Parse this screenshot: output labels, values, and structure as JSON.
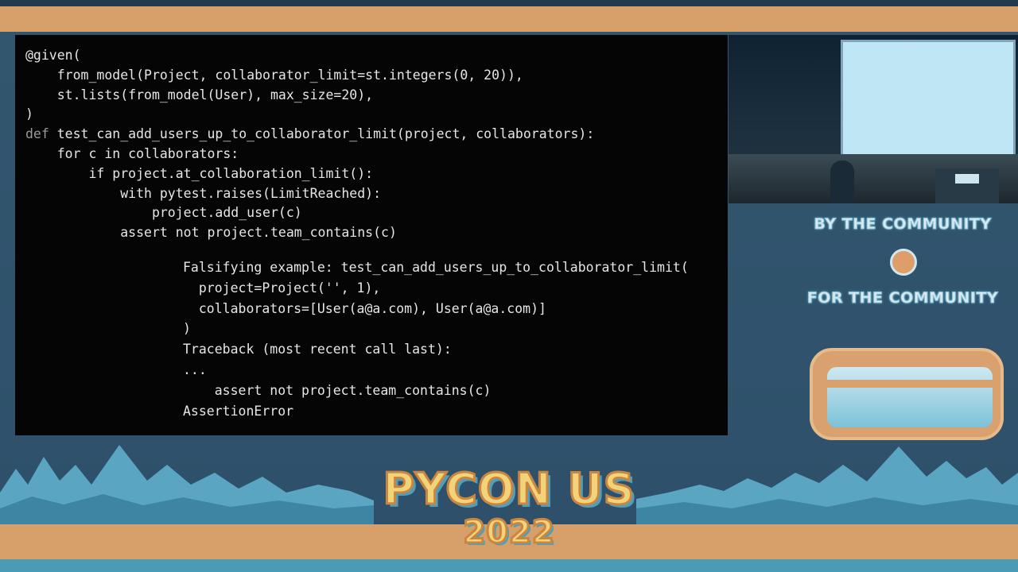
{
  "code": {
    "lines": [
      {
        "kw": "",
        "text": "@given("
      },
      {
        "kw": "",
        "text": "    from_model(Project, collaborator_limit=st.integers(0, 20)),"
      },
      {
        "kw": "",
        "text": "    st.lists(from_model(User), max_size=20),"
      },
      {
        "kw": "",
        "text": ")"
      },
      {
        "kw": "def",
        "text": " test_can_add_users_up_to_collaborator_limit(project, collaborators):"
      },
      {
        "kw": "",
        "text": "    for c in collaborators:"
      },
      {
        "kw": "",
        "text": "        if project.at_collaboration_limit():"
      },
      {
        "kw": "",
        "text": "            with pytest.raises(LimitReached):"
      },
      {
        "kw": "",
        "text": "                project.add_user(c)"
      },
      {
        "kw": "",
        "text": "            assert not project.team_contains(c)"
      }
    ]
  },
  "output": {
    "lines": [
      "Falsifying example: test_can_add_users_up_to_collaborator_limit(",
      "  project=Project('', 1),",
      "  collaborators=[User(a@a.com), User(a@a.com)]",
      ")",
      "Traceback (most recent call last):",
      "...",
      "    assert not project.team_contains(c)",
      "AssertionError"
    ]
  },
  "sidebar": {
    "slogan_top": "BY THE COMMUNITY",
    "slogan_bottom": "FOR THE COMMUNITY"
  },
  "event": {
    "name": "PYCON US",
    "year": "2022"
  },
  "colors": {
    "code_bg": "#050505",
    "code_text": "#e6e6e6",
    "tan": "#d7a06b",
    "navy": "#2c4a60",
    "teal": "#4a9cb5"
  }
}
